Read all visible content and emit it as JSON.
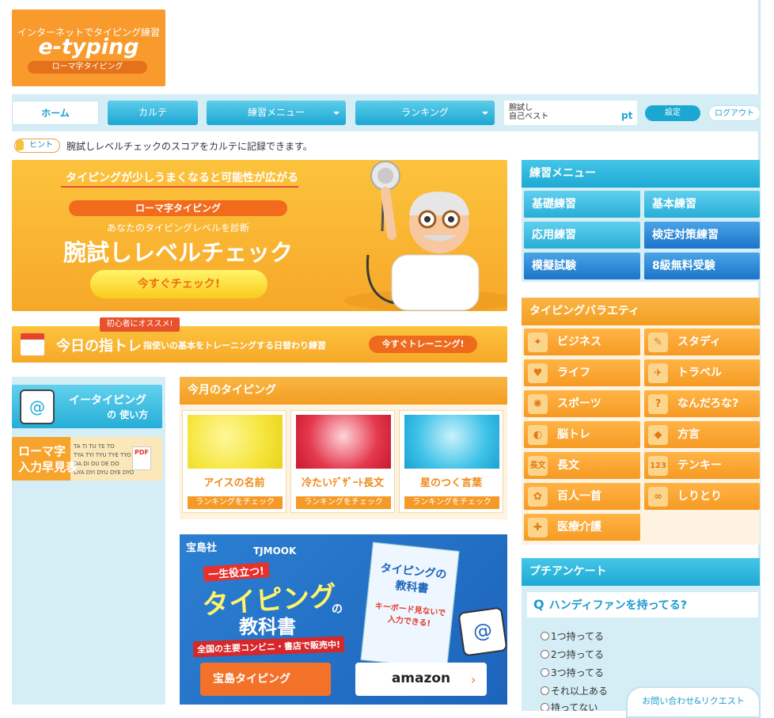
{
  "logo": {
    "tagline": "インターネットでタイピング練習",
    "name": "e-typing",
    "sub": "ローマ字タイピング"
  },
  "nav": {
    "home": "ホーム",
    "karte": "カルテ",
    "practice": "練習メニュー",
    "ranking": "ランキング",
    "score_line1": "腕試し",
    "score_line2": "自己ベスト",
    "score_unit": "pt",
    "settings": "設定",
    "logout": "ログアウト"
  },
  "hint": {
    "label": "ヒント",
    "text": "腕試しレベルチェックのスコアをカルテに記録できます。"
  },
  "main_banner": {
    "headline": "タイピングが少しうまくなると可能性が広がる",
    "badge": "ローマ字タイピング",
    "lead": "あなたのタイピングレベルを診断",
    "title": "腕試しレベルチェック",
    "cta": "今すぐチェック!"
  },
  "daily": {
    "tag": "初心者にオススメ!",
    "title": "今日の指トレ",
    "desc": "指使いの基本をトレーニングする日替わり練習",
    "cta": "今すぐトレーニング!"
  },
  "side_left": {
    "usage_line1": "イータイピング",
    "usage_line2": "の 使い方",
    "romaji_line1": "ローマ字",
    "romaji_line2": "入力早見表",
    "romaji_table": [
      "TA TI TU TE TO",
      "TYA TYI TYU TYE TYO",
      "DA DI DU DE DO",
      "DYA DYI DYU DYE DYO"
    ],
    "pdf": "PDF"
  },
  "monthly": {
    "heading": "今月のタイピング",
    "items": [
      {
        "title": "アイスの名前",
        "ranking": "ランキングをチェック",
        "color": "#f5e53a"
      },
      {
        "title": "冷たいﾃﾞｻﾞｰﾄ長文",
        "ranking": "ランキングをチェック",
        "color": "#e4384d"
      },
      {
        "title": "星のつく言葉",
        "ranking": "ランキングをチェック",
        "color": "#3fc2e8"
      }
    ]
  },
  "ad": {
    "publisher": "宝島社",
    "mook": "TJMOOK",
    "catch": "一生役立つ!",
    "title": "タイピング",
    "title_no": "の",
    "title2": "教科書",
    "sales": "全国の主要コンビニ・書店で販売中!",
    "btn1": "宝島タイピング",
    "btn2": "amazon",
    "book_title": "タイピングの教科書",
    "book_catch": "キーボード見ないで入力できる!"
  },
  "practice_menu": {
    "heading": "練習メニュー",
    "items": [
      "基礎練習",
      "基本練習",
      "応用練習",
      "検定対策練習",
      "模擬試験",
      "8級無料受験"
    ]
  },
  "variety": {
    "heading": "タイピングバラエティ",
    "items": [
      {
        "label": "ビジネス",
        "icon": "necktie-icon"
      },
      {
        "label": "スタディ",
        "icon": "notebook-icon"
      },
      {
        "label": "ライフ",
        "icon": "heart-icon"
      },
      {
        "label": "トラベル",
        "icon": "airplane-icon"
      },
      {
        "label": "スポーツ",
        "icon": "racket-icon"
      },
      {
        "label": "なんだろな?",
        "icon": "question-icon"
      },
      {
        "label": "脳トレ",
        "icon": "brain-icon"
      },
      {
        "label": "方言",
        "icon": "japan-map-icon"
      },
      {
        "label": "長文",
        "icon": "long-text-icon"
      },
      {
        "label": "テンキー",
        "icon": "numbers-icon"
      },
      {
        "label": "百人一首",
        "icon": "karuta-icon"
      },
      {
        "label": "しりとり",
        "icon": "chain-icon"
      },
      {
        "label": "医療介護",
        "icon": "syringe-icon"
      }
    ],
    "icon_glyphs": [
      "✦",
      "✎",
      "♥",
      "✈",
      "✺",
      "?",
      "◐",
      "◆",
      "長文",
      "123",
      "✿",
      "∞",
      "✚"
    ]
  },
  "survey": {
    "heading": "プチアンケート",
    "question": "ハンディファンを持ってる?",
    "options": [
      "1つ持ってる",
      "2つ持ってる",
      "3つ持ってる",
      "それ以上ある",
      "持ってない"
    ],
    "contact": "お問い合わせ&リクエスト"
  }
}
